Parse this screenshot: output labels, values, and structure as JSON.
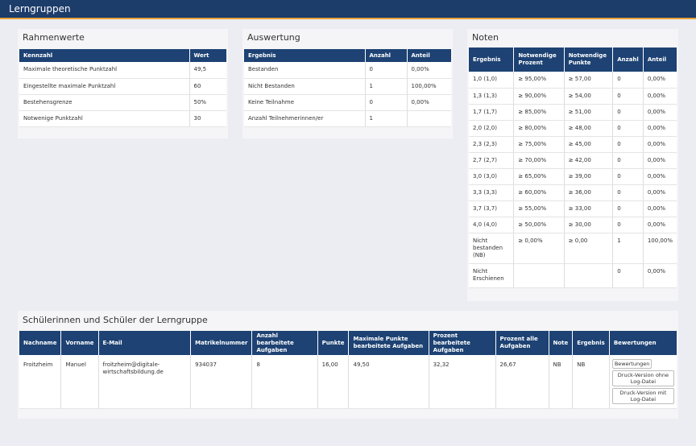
{
  "header": {
    "title": "Lerngruppen"
  },
  "rahmen": {
    "title": "Rahmenwerte",
    "headers": [
      "Kennzahl",
      "Wert"
    ],
    "rows": [
      [
        "Maximale theoretische Punktzahl",
        "49,5"
      ],
      [
        "Eingestellte maximale Punktzahl",
        "60"
      ],
      [
        "Bestehensgrenze",
        "50%"
      ],
      [
        "Notwenige Punktzahl",
        "30"
      ]
    ]
  },
  "auswertung": {
    "title": "Auswertung",
    "headers": [
      "Ergebnis",
      "Anzahl",
      "Anteil"
    ],
    "rows": [
      [
        "Bestanden",
        "0",
        "0,00%"
      ],
      [
        "Nicht Bestanden",
        "1",
        "100,00%"
      ],
      [
        "Keine Teilnahme",
        "0",
        "0,00%"
      ],
      [
        "Anzahl Teilnehmerinnen/er",
        "1",
        ""
      ]
    ]
  },
  "noten": {
    "title": "Noten",
    "headers": [
      "Ergebnis",
      "Notwendige Prozent",
      "Notwendige Punkte",
      "Anzahl",
      "Anteil"
    ],
    "rows": [
      [
        "1,0 (1,0)",
        "≥ 95,00%",
        "≥ 57,00",
        "0",
        "0,00%"
      ],
      [
        "1,3 (1,3)",
        "≥ 90,00%",
        "≥ 54,00",
        "0",
        "0,00%"
      ],
      [
        "1,7 (1,7)",
        "≥ 85,00%",
        "≥ 51,00",
        "0",
        "0,00%"
      ],
      [
        "2,0 (2,0)",
        "≥ 80,00%",
        "≥ 48,00",
        "0",
        "0,00%"
      ],
      [
        "2,3 (2,3)",
        "≥ 75,00%",
        "≥ 45,00",
        "0",
        "0,00%"
      ],
      [
        "2,7 (2,7)",
        "≥ 70,00%",
        "≥ 42,00",
        "0",
        "0,00%"
      ],
      [
        "3,0 (3,0)",
        "≥ 65,00%",
        "≥ 39,00",
        "0",
        "0,00%"
      ],
      [
        "3,3 (3,3)",
        "≥ 60,00%",
        "≥ 36,00",
        "0",
        "0,00%"
      ],
      [
        "3,7 (3,7)",
        "≥ 55,00%",
        "≥ 33,00",
        "0",
        "0,00%"
      ],
      [
        "4,0 (4,0)",
        "≥ 50,00%",
        "≥ 30,00",
        "0",
        "0,00%"
      ],
      [
        "Nicht bestanden (NB)",
        "≥ 0,00%",
        "≥ 0,00",
        "1",
        "100,00%"
      ],
      [
        "Nicht Erschienen",
        "",
        "",
        "0",
        "0,00%"
      ]
    ]
  },
  "schueler": {
    "title": "Schülerinnen und Schüler der Lerngruppe",
    "headers": [
      "Nachname",
      "Vorname",
      "E-Mail",
      "Matrikelnummer",
      "Anzahl bearbeitete Aufgaben",
      "Punkte",
      "Maximale Punkte bearbeitete Aufgaben",
      "Prozent bearbeitete Aufgaben",
      "Prozent alle Aufgaben",
      "Note",
      "Ergebnis",
      "Bewertungen"
    ],
    "rows": [
      [
        "Froitzheim",
        "Manuel",
        "froitzheim@digitale-wirtschaftsbildung.de",
        "934037",
        "8",
        "16,00",
        "49,50",
        "32,32",
        "26,67",
        "NB",
        "NB"
      ]
    ],
    "buttons": [
      "Bewertungen",
      "Druck-Version ohne Log-Datei",
      "Druck-Version mit Log-Datei"
    ]
  }
}
